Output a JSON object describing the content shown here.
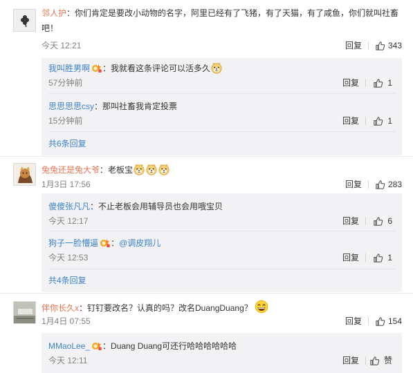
{
  "comments": [
    {
      "user": "邻人护",
      "text": "：你们肯定是要改小动物的名字，阿里已经有了飞猪，有了天猫，有了咸鱼，你们就叫社畜吧！",
      "time": "今天 12:21",
      "reply": "回复",
      "likes": "343",
      "subs": [
        {
          "user": "我叫胜男啊",
          "text": "：我就看这条评论可以活多久",
          "time": "57分钟前",
          "reply": "回复",
          "likes": "1"
        },
        {
          "user": "思思思思csy",
          "text": "：那叫社畜我肯定投票",
          "time": "15分钟前",
          "reply": "回复",
          "likes": "1"
        }
      ],
      "more": "共6条回复"
    },
    {
      "user": "兔兔还是兔大爷",
      "text": "：老板宝",
      "time": "1月3日 17:56",
      "reply": "回复",
      "likes": "283",
      "subs": [
        {
          "user": "傻傻张凡凡",
          "text": "：不止老板会用辅导员也会用哦宝贝",
          "time": "今天 12:17",
          "reply": "回复",
          "likes": "6"
        },
        {
          "user": "狗子一脸懵逼",
          "text": "：",
          "mention": "@调皮翔儿",
          "time": "今天 12:53",
          "reply": "回复",
          "likes": "1"
        }
      ],
      "more": "共4条回复"
    },
    {
      "user": "伴你长久x",
      "text": "：钉钉要改名？认真的吗？改名DuangDuang？",
      "time": "1月4日 07:55",
      "reply": "回复",
      "likes": "154",
      "subs": [
        {
          "user": "MMaoLee_",
          "text": "：Duang Duang可还行哈哈哈哈哈哈",
          "time": "今天 12:11",
          "reply": "回复",
          "likes": "赞"
        }
      ]
    }
  ],
  "colors": {
    "username": "#eb7350",
    "link": "#3c82c8",
    "meta": "#808080",
    "subBg": "#f2f2f5"
  },
  "icons": {
    "like": "thumbs-up-icon",
    "badge": "vip-badge-icon",
    "emoji": "doge-emoji-icon",
    "laugh": "laugh-emoji-icon"
  }
}
